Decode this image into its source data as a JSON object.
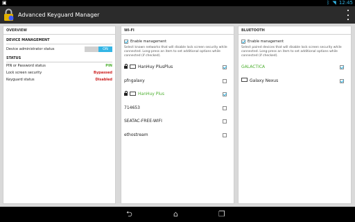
{
  "status": {
    "time": "12:45"
  },
  "app": {
    "title": "Advanced Keyguard Manager"
  },
  "overview": {
    "title": "OVERVIEW",
    "device_management": {
      "heading": "DEVICE MANAGEMENT",
      "admin_label": "Device administrator status",
      "toggle_value": "ON"
    },
    "status": {
      "heading": "STATUS",
      "rows": [
        {
          "label": "PIN or Password status",
          "value": "PIN",
          "color": "#4caf2f"
        },
        {
          "label": "Lock screen security",
          "value": "Bypassed",
          "color": "#cc1f1f"
        },
        {
          "label": "Keyguard status",
          "value": "Disabled",
          "color": "#cc1f1f"
        }
      ]
    }
  },
  "wifi": {
    "title": "WI-FI",
    "enable_label": "Enable management",
    "description": "Select known networks that will disable lock screen security while connected. Long-press an item to set additional options while connected (if checked).",
    "networks": [
      {
        "name": "HanHuy PlusPlus",
        "locked": true,
        "checked": true,
        "active": false
      },
      {
        "name": "pfngalaxy",
        "locked": false,
        "checked": false,
        "active": false
      },
      {
        "name": "HanHuy Plus",
        "locked": true,
        "checked": true,
        "active": true
      },
      {
        "name": "714653",
        "locked": false,
        "checked": false,
        "active": false
      },
      {
        "name": "SEATAC-FREE-WIFI",
        "locked": false,
        "checked": false,
        "active": false
      },
      {
        "name": "ethostream",
        "locked": false,
        "checked": false,
        "active": false
      }
    ]
  },
  "bluetooth": {
    "title": "BLUETOOTH",
    "enable_label": "Enable management",
    "description": "Select paired devices that will disable lock screen security while connected. Long-press an item to set additional options while connected (if checked).",
    "devices": [
      {
        "name": "GALACTICA",
        "icon": false,
        "checked": true,
        "active": true
      },
      {
        "name": "Galaxy Nexus",
        "icon": true,
        "checked": true,
        "active": false
      }
    ]
  },
  "accent_color": "#33b5e5"
}
